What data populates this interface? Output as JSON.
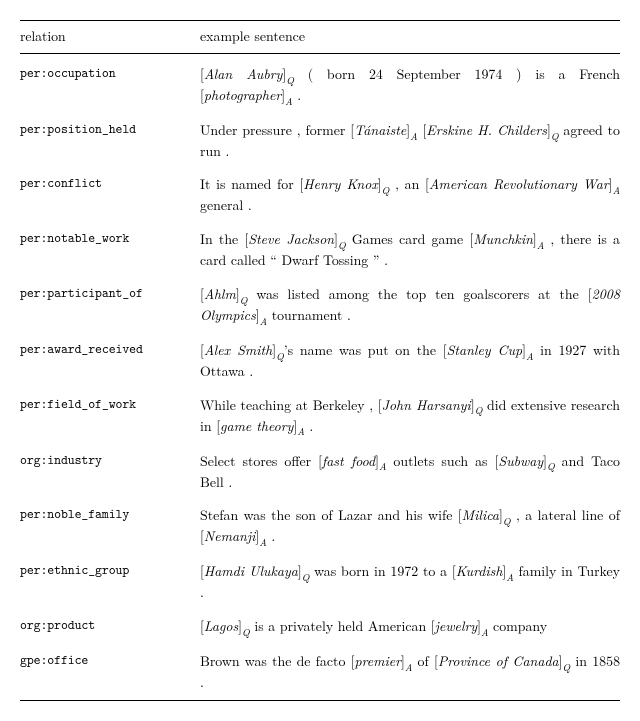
{
  "table": {
    "header": {
      "relation": "relation",
      "example": "example sentence"
    },
    "rows": [
      {
        "relation": "per:occupation",
        "parts": [
          "[",
          "Alan Aubry",
          "]",
          "Q",
          " ( born 24 September 1974 ) is a French [",
          "photographer",
          "]",
          "A",
          " ."
        ]
      },
      {
        "relation": "per:position_held",
        "parts": [
          "Under pressure , former [",
          "Tánaiste",
          "]",
          "A",
          " [",
          "Erskine H. Childers",
          "]",
          "Q",
          " agreed to run ."
        ]
      },
      {
        "relation": "per:conflict",
        "parts": [
          "It is named for [",
          "Henry Knox",
          "]",
          "Q",
          " , an [",
          "American Revolutionary War",
          "]",
          "A",
          " general ."
        ]
      },
      {
        "relation": "per:notable_work",
        "parts": [
          "In the [",
          "Steve Jackson",
          "]",
          "Q",
          " Games card game [",
          "Munchkin",
          "]",
          "A",
          " , there is a card called “ Dwarf Tossing ” ."
        ]
      },
      {
        "relation": "per:participant_of",
        "parts": [
          "[",
          "Ahlm",
          "]",
          "Q",
          " was listed among the top ten goalscorers at the [",
          "2008 Olympics",
          "]",
          "A",
          " tournament ."
        ]
      },
      {
        "relation": "per:award_received",
        "parts": [
          "[",
          "Alex Smith",
          "]",
          "Q",
          "’s name was put on the [",
          "Stanley Cup",
          "]",
          "A",
          " in 1927 with Ottawa ."
        ]
      },
      {
        "relation": "per:field_of_work",
        "parts": [
          "While teaching at Berkeley , [",
          "John Harsanyi",
          "]",
          "Q",
          " did extensive research in [",
          "game theory",
          "]",
          "A",
          " ."
        ]
      },
      {
        "relation": "org:industry",
        "parts": [
          "Select stores offer [",
          "fast food",
          "]",
          "A",
          " outlets such as [",
          "Subway",
          "]",
          "Q",
          " and Taco Bell ."
        ]
      },
      {
        "relation": "per:noble_family",
        "parts": [
          "Stefan was the son of Lazar and his wife [",
          "Milica",
          "]",
          "Q",
          " , a lateral line of [",
          "Nemanji",
          "]",
          "A",
          " ."
        ]
      },
      {
        "relation": "per:ethnic_group",
        "parts": [
          "[",
          "Hamdi Ulukaya",
          "]",
          "Q",
          " was born in 1972 to a [",
          "Kurdish",
          "]",
          "A",
          " family in Turkey ."
        ]
      },
      {
        "relation": "org:product",
        "parts": [
          "[",
          "Lagos",
          "]",
          "Q",
          " is a privately held American [",
          "jewelry",
          "]",
          "A",
          " company"
        ]
      },
      {
        "relation": "gpe:office",
        "parts": [
          "Brown was the de facto [",
          "premier",
          "]",
          "A",
          " of [",
          "Province of Canada",
          "]",
          "Q",
          " in 1858 ."
        ]
      }
    ]
  }
}
